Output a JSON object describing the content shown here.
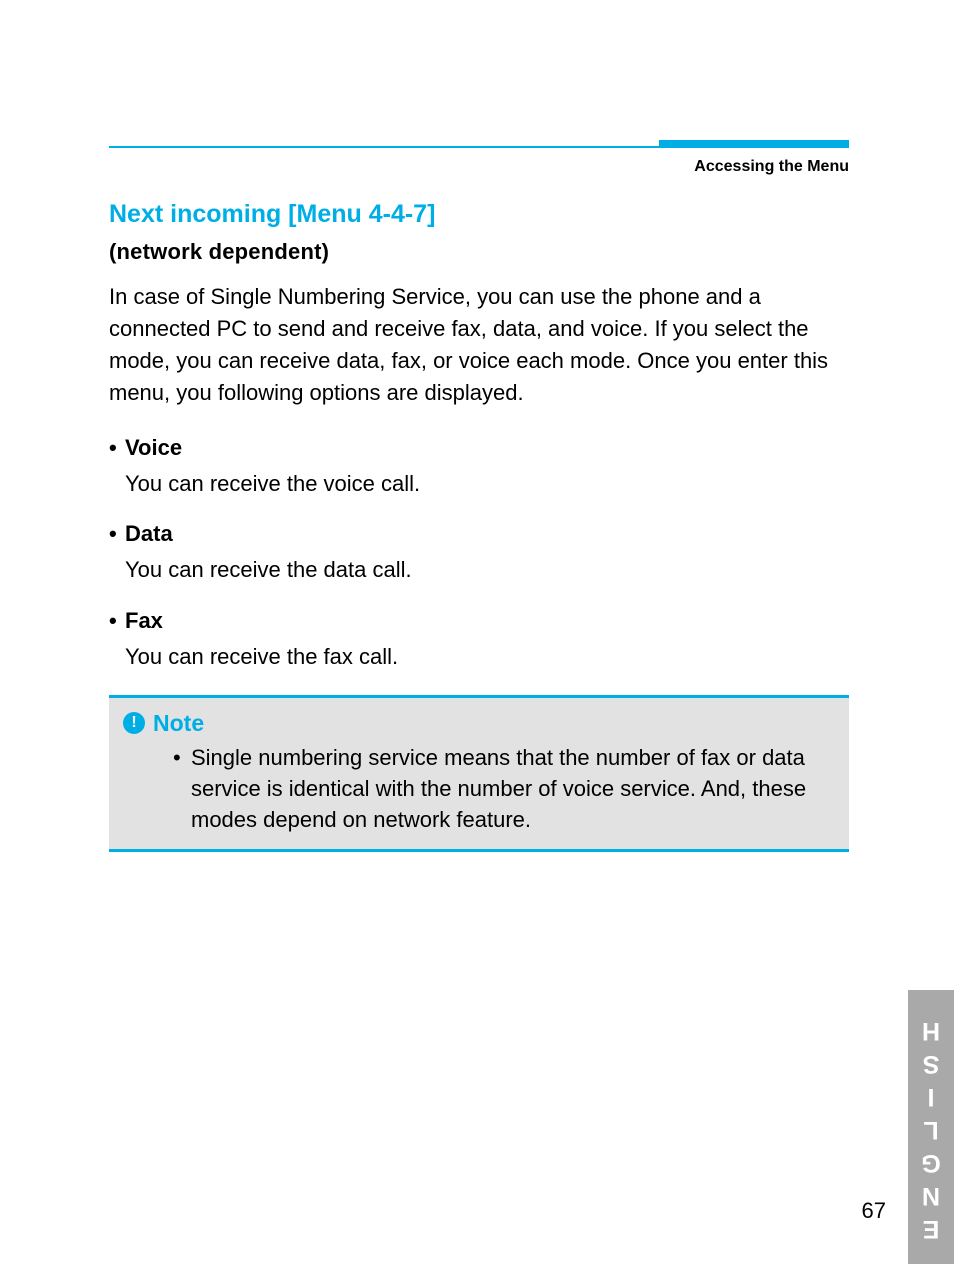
{
  "header": {
    "running": "Accessing the Menu"
  },
  "section": {
    "title": "Next incoming [Menu 4-4-7]",
    "subtitle": "(network dependent)",
    "body": "In case of Single Numbering Service, you can use the phone and a connected PC to send and receive fax, data, and voice. If you select the mode, you can receive data, fax, or voice each mode. Once you enter this menu, you following options are displayed."
  },
  "items": [
    {
      "label": "Voice",
      "desc": "You can receive the voice call."
    },
    {
      "label": "Data",
      "desc": "You can receive the data call."
    },
    {
      "label": "Fax",
      "desc": "You can receive the fax call."
    }
  ],
  "note": {
    "title": "Note",
    "body": "Single numbering service means that the number of fax or data service is identical with the number of voice service. And, these modes depend on network feature."
  },
  "sideTab": "ENGLISH",
  "pageNumber": "67",
  "glyphs": {
    "bullet": "•",
    "smallBullet": "•",
    "exclaim": "!"
  }
}
